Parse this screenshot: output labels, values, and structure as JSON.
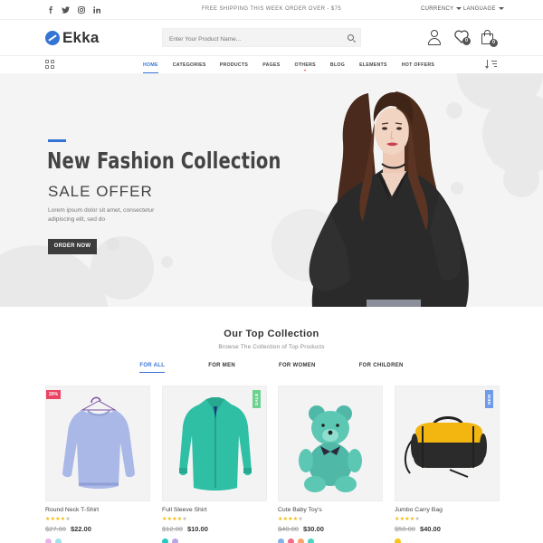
{
  "topbar": {
    "social": [
      "f",
      "t",
      "ig",
      "in"
    ],
    "shipping": "FREE SHIPPING THIS WEEK ORDER OVER - $75",
    "currency": "CURRENCY",
    "language": "LANGUAGE"
  },
  "header": {
    "logo": "Ekka",
    "search_placeholder": "Enter Your Product Name...",
    "wishlist_count": "0",
    "cart_count": "0"
  },
  "nav": {
    "items": [
      "HOME",
      "CATEGORIES",
      "PRODUCTS",
      "PAGES",
      "OTHERS",
      "BLOG",
      "ELEMENTS",
      "HOT OFFERS"
    ],
    "active": "HOME"
  },
  "hero": {
    "title": "New Fashion Collection",
    "subtitle": "SALE OFFER",
    "description": "Lorem ipsum dolor sit amet, consectetur adipiscing elit, sed do",
    "cta": "ORDER NOW"
  },
  "collection": {
    "title": "Our Top Collection",
    "subtitle": "Browse The Collection of Top Products",
    "tabs": [
      "FOR ALL",
      "FOR MEN",
      "FOR WOMEN",
      "FOR CHILDREN"
    ],
    "active_tab": "FOR ALL"
  },
  "products": [
    {
      "name": "Round Neck T-Shirt",
      "old_price": "$27.00",
      "new_price": "$22.00",
      "rating": 4,
      "tag": "20%",
      "tag_color": "#ec4463",
      "image": "sweater-icon",
      "swatches": [
        "#e8b4e8",
        "#9fe3e8"
      ]
    },
    {
      "name": "Full Sleeve Shirt",
      "old_price": "$12.00",
      "new_price": "$10.00",
      "rating": 4,
      "tag": "SALE",
      "tag_color": "#6dd28f",
      "image": "shirt-icon",
      "swatches": [
        "#27c8c0",
        "#b9a6e6"
      ]
    },
    {
      "name": "Cute Baby Toy's",
      "old_price": "$40.00",
      "new_price": "$30.00",
      "rating": 4,
      "tag": "",
      "tag_color": "",
      "image": "teddy-bear-icon",
      "swatches": [
        "#7fb4ea",
        "#ef6c8a",
        "#f5a66b",
        "#48d6c2"
      ]
    },
    {
      "name": "Jumbo Carry Bag",
      "old_price": "$50.00",
      "new_price": "$40.00",
      "rating": 4,
      "tag": "NEW",
      "tag_color": "#6f9be8",
      "image": "duffel-bag-icon",
      "swatches": [
        "#f5c518"
      ]
    }
  ],
  "colors": {
    "accent": "#3474d4",
    "dark": "#3d3d3d",
    "star": "#f5b90a"
  }
}
